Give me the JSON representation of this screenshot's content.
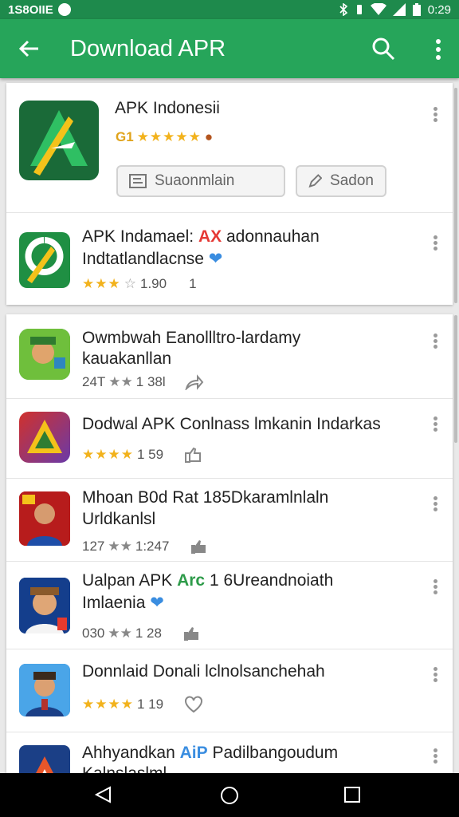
{
  "status_bar": {
    "left_text": "1S8OIIE",
    "time": "0:29"
  },
  "app_bar": {
    "title": "Download APR"
  },
  "featured": {
    "name": "APK Indonesii",
    "rating_prefix": "G1",
    "stars": "★★★★★",
    "button_primary": "Suaonmlain",
    "button_secondary": "Sadon"
  },
  "second": {
    "name_line1": "APK Indamael:",
    "name_badge": "AX",
    "name_line1_tail": "adonnauhan",
    "name_line2": "Indtatlandlacnse",
    "stars": "★★★",
    "stars_gray": "☆",
    "rating": "1.90",
    "count": "1"
  },
  "list": [
    {
      "name_line1": "Owmbwah Eanollltro-lardamy",
      "name_line2": "kauakanllan",
      "meta_prefix": "24T",
      "stars": "★★",
      "rating": "1 38l",
      "action": "share-icon",
      "icon_colors": [
        "#1d7a2e",
        "#7bc043"
      ]
    },
    {
      "name_line1": "Dodwal APK Conlnass lmkanin Indarkas",
      "name_line2": "",
      "meta_prefix": "",
      "stars": "★★★★",
      "rating": "1 59",
      "action": "thumb-icon",
      "icon_colors": [
        "#d1312b",
        "#6a3aa8"
      ]
    },
    {
      "name_line1": "Mhoan B0d Rat 185Dkaramlnlaln",
      "name_line2": "Urldkanlsl",
      "meta_prefix": "127",
      "stars": "★★",
      "rating": "1:247",
      "action": "thumb-icon",
      "icon_colors": [
        "#c62828",
        "#1e4ea8"
      ]
    },
    {
      "name_line1": "Ualpan APK",
      "name_badge": "Arc",
      "name_line1_tail": "1 6Ureandnoiath",
      "name_line2": "Imlaenia",
      "meta_prefix": "030",
      "stars": "★★",
      "rating": "1 28",
      "action": "thumb-icon",
      "icon_colors": [
        "#143e8c",
        "#e63a2e"
      ]
    },
    {
      "name_line1": "Donnlaid Donali lclnolsanchehah",
      "name_line2": "",
      "meta_prefix": "",
      "stars": "★★★★",
      "rating": "1 19",
      "action": "heart-icon",
      "icon_colors": [
        "#2a8ad6",
        "#b3332d"
      ]
    },
    {
      "name_line1": "Ahhyandkan",
      "name_badge": "AiP",
      "name_line1_tail": "Padilbangoudum",
      "name_line2": "Kalnslaslml",
      "meta_prefix": "",
      "stars": "",
      "rating": "",
      "action": "",
      "icon_colors": [
        "#1b3f86",
        "#e8562a"
      ]
    }
  ]
}
